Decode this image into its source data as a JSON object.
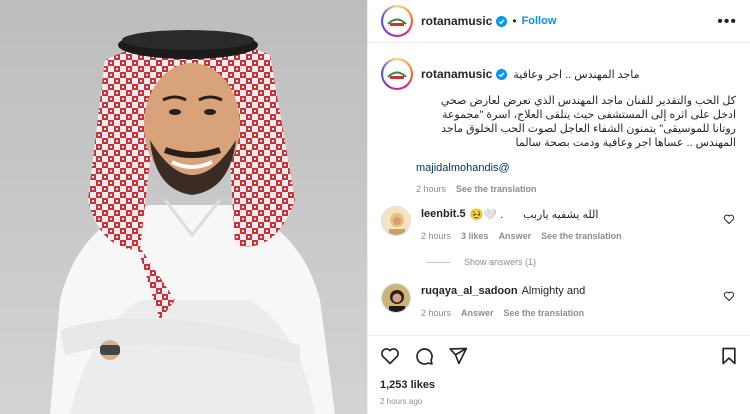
{
  "header": {
    "username": "rotanamusic",
    "verified": true,
    "separator": "•",
    "follow_label": "Follow",
    "more_label": "•••"
  },
  "caption": {
    "username": "rotanamusic",
    "title": "ماجد المهندس .. اجر وعافية",
    "body": "كل الحب والتقدير للفنان ماجد المهندس الذي تعرض لعارض صحي ادخل على اثره إلى المستشفى حيث يتلقى العلاج، اسرة \"مجموعة روتانا للموسيقى\" يتمنون الشفاء العاجل لصوت الحب الخلوق ماجد المهندس .. عساها اجر وعافية ودمت بصحة سالما",
    "mention": "majidalmohandis@",
    "time": "2 hours",
    "translate": "See the translation"
  },
  "comments": [
    {
      "username": "leenbit.5",
      "text": "الله يشفيه ياربب",
      "emoji": "🥹🤍 .",
      "time": "2 hours",
      "likes": "3 likes",
      "answer": "Answer",
      "translate": "See the translation"
    },
    {
      "username": "ruqaya_al_sadoon",
      "text": "Almighty and",
      "time": "2 hours",
      "answer": "Answer",
      "translate": "See the translation"
    }
  ],
  "show_answers": "Show answers (1)",
  "likes": "1,253 likes",
  "posted": "2 hours ago",
  "colors": {
    "link_blue": "#0095f6",
    "muted": "#8e8e8e",
    "photo_bg": "#c9c9c9"
  }
}
